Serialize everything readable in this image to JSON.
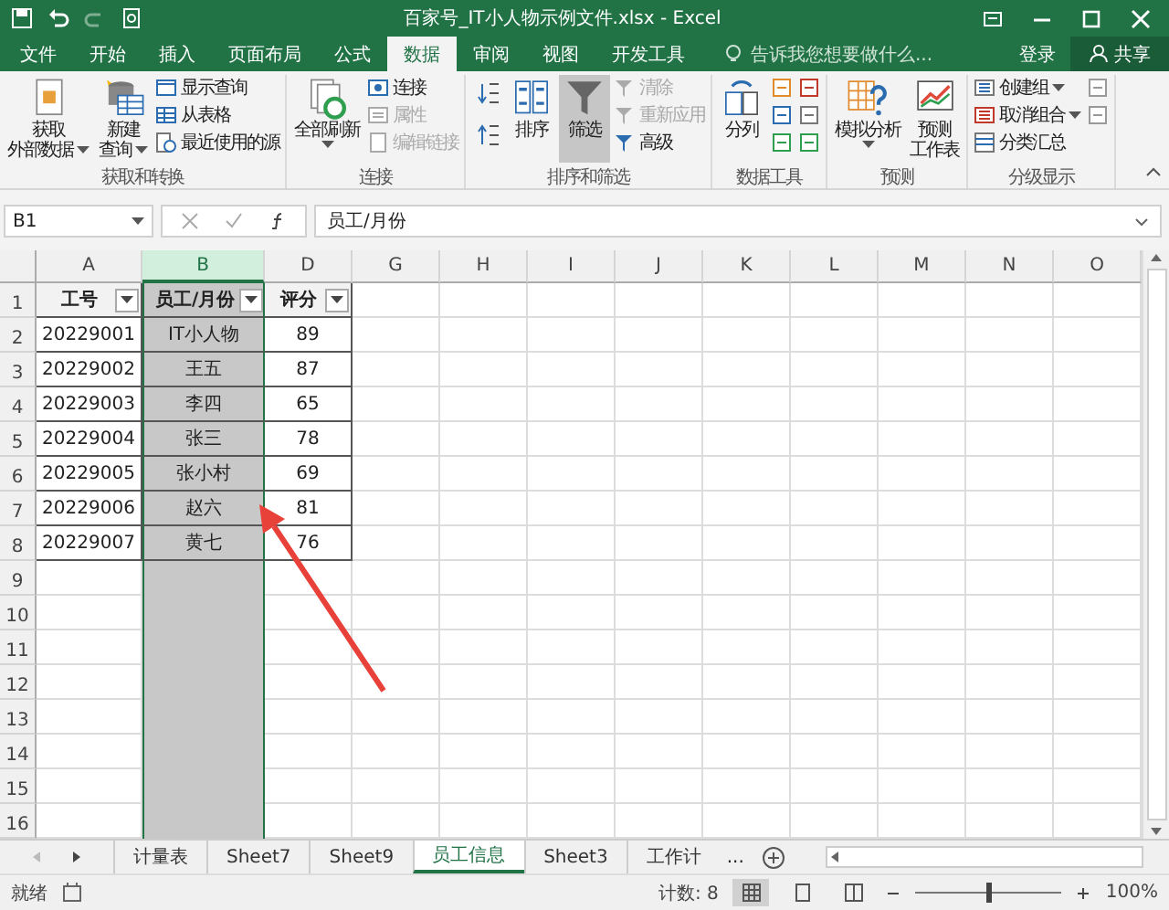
{
  "window": {
    "title": "百家号_IT小人物示例文件.xlsx - Excel"
  },
  "tabs": [
    {
      "label": "文件",
      "selected": false
    },
    {
      "label": "开始",
      "selected": false
    },
    {
      "label": "插入",
      "selected": false
    },
    {
      "label": "页面布局",
      "selected": false
    },
    {
      "label": "公式",
      "selected": false
    },
    {
      "label": "数据",
      "selected": true
    },
    {
      "label": "审阅",
      "selected": false
    },
    {
      "label": "视图",
      "selected": false
    },
    {
      "label": "开发工具",
      "selected": false
    }
  ],
  "tell_me": {
    "placeholder": "告诉我您想要做什么..."
  },
  "sign_in": "登录",
  "share": "共享",
  "ribbon_groups": [
    {
      "label": "获取和转换",
      "items": [
        {
          "kind": "large",
          "lines": [
            "获取",
            "外部数据"
          ],
          "dropdown": true,
          "disabled": false,
          "selected": false
        },
        {
          "kind": "large",
          "lines": [
            "新建",
            "查询"
          ],
          "dropdown": true,
          "disabled": false,
          "selected": false
        },
        {
          "kind": "small",
          "label": "显示查询",
          "dropdown": false,
          "disabled": false,
          "selected": false
        },
        {
          "kind": "small",
          "label": "从表格",
          "dropdown": false,
          "disabled": false,
          "selected": false
        },
        {
          "kind": "small",
          "label": "最近使用的源",
          "dropdown": false,
          "disabled": false,
          "selected": false
        }
      ]
    },
    {
      "label": "连接",
      "items": [
        {
          "kind": "large",
          "lines": [
            "全部刷新"
          ],
          "dropdown": true,
          "disabled": false,
          "selected": false
        },
        {
          "kind": "small",
          "label": "连接",
          "dropdown": false,
          "disabled": false,
          "selected": false
        },
        {
          "kind": "small",
          "label": "属性",
          "dropdown": false,
          "disabled": true,
          "selected": false
        },
        {
          "kind": "small",
          "label": "编辑链接",
          "dropdown": false,
          "disabled": true,
          "selected": false
        }
      ]
    },
    {
      "label": "排序和筛选",
      "items": [
        {
          "kind": "large",
          "lines": [
            "排序"
          ],
          "dropdown": false,
          "disabled": false,
          "selected": false
        },
        {
          "kind": "large",
          "lines": [
            "筛选"
          ],
          "dropdown": false,
          "disabled": false,
          "selected": true
        },
        {
          "kind": "small",
          "label": "清除",
          "dropdown": false,
          "disabled": true,
          "selected": false
        },
        {
          "kind": "small",
          "label": "重新应用",
          "dropdown": false,
          "disabled": true,
          "selected": false
        },
        {
          "kind": "small",
          "label": "高级",
          "dropdown": false,
          "disabled": false,
          "selected": false
        }
      ]
    },
    {
      "label": "数据工具",
      "items": [
        {
          "kind": "large",
          "lines": [
            "分列"
          ],
          "dropdown": false,
          "disabled": false,
          "selected": false
        }
      ]
    },
    {
      "label": "预测",
      "items": [
        {
          "kind": "large",
          "lines": [
            "模拟分析"
          ],
          "dropdown": true,
          "disabled": false,
          "selected": false
        },
        {
          "kind": "large",
          "lines": [
            "预测",
            "工作表"
          ],
          "dropdown": false,
          "disabled": false,
          "selected": false
        }
      ]
    },
    {
      "label": "分级显示",
      "items": [
        {
          "kind": "small",
          "label": "创建组",
          "dropdown": true,
          "disabled": false,
          "selected": false
        },
        {
          "kind": "small",
          "label": "取消组合",
          "dropdown": true,
          "disabled": false,
          "selected": false
        },
        {
          "kind": "small",
          "label": "分类汇总",
          "dropdown": false,
          "disabled": false,
          "selected": false
        }
      ]
    }
  ],
  "name_box": "B1",
  "formula": "员工/月份",
  "columns": [
    {
      "label": "A",
      "selected": false
    },
    {
      "label": "B",
      "selected": true
    },
    {
      "label": "D",
      "selected": false
    },
    {
      "label": "G",
      "selected": false
    },
    {
      "label": "H",
      "selected": false
    },
    {
      "label": "I",
      "selected": false
    },
    {
      "label": "J",
      "selected": false
    },
    {
      "label": "K",
      "selected": false
    },
    {
      "label": "L",
      "selected": false
    },
    {
      "label": "M",
      "selected": false
    },
    {
      "label": "N",
      "selected": false
    },
    {
      "label": "O",
      "selected": false
    }
  ],
  "row_numbers": [
    "1",
    "2",
    "3",
    "4",
    "5",
    "6",
    "7",
    "8",
    "9",
    "10",
    "11",
    "12",
    "13",
    "14",
    "15",
    "16"
  ],
  "table": {
    "headers": [
      "工号",
      "员工/月份",
      "评分"
    ],
    "rows": [
      [
        "20229001",
        "IT小人物",
        "89"
      ],
      [
        "20229002",
        "王五",
        "87"
      ],
      [
        "20229003",
        "李四",
        "65"
      ],
      [
        "20229004",
        "张三",
        "78"
      ],
      [
        "20229005",
        "张小村",
        "69"
      ],
      [
        "20229006",
        "赵六",
        "81"
      ],
      [
        "20229007",
        "黄七",
        "76"
      ]
    ]
  },
  "sheets": [
    {
      "label": "计量表",
      "selected": false
    },
    {
      "label": "Sheet7",
      "selected": false
    },
    {
      "label": "Sheet9",
      "selected": false
    },
    {
      "label": "员工信息",
      "selected": true
    },
    {
      "label": "Sheet3",
      "selected": false
    },
    {
      "label": "工作计",
      "selected": false
    }
  ],
  "more_sheets": "...",
  "status_bar": {
    "ready": "就绪",
    "count": "计数: 8",
    "zoom": {
      "level": 0.5,
      "reading": "100%"
    }
  }
}
